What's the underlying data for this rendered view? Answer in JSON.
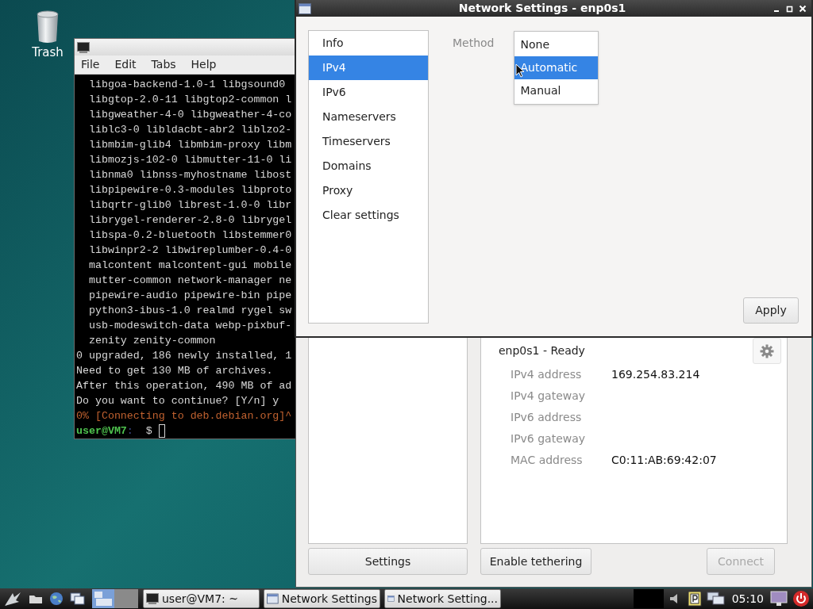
{
  "desktop_icons": [
    {
      "label": "Trash"
    }
  ],
  "terminal": {
    "menu": [
      "File",
      "Edit",
      "Tabs",
      "Help"
    ],
    "lines": [
      {
        "kind": "output",
        "text": "  libgoa-backend-1.0-1 libgsound0"
      },
      {
        "kind": "output",
        "text": "  libgtop-2.0-11 libgtop2-common l"
      },
      {
        "kind": "output",
        "text": "  libgweather-4-0 libgweather-4-co"
      },
      {
        "kind": "output",
        "text": "  liblc3-0 libldacbt-abr2 liblzo2-"
      },
      {
        "kind": "output",
        "text": "  libmbim-glib4 libmbim-proxy libm"
      },
      {
        "kind": "output",
        "text": "  libmozjs-102-0 libmutter-11-0 li"
      },
      {
        "kind": "output",
        "text": "  libnma0 libnss-myhostname libost"
      },
      {
        "kind": "output",
        "text": "  libpipewire-0.3-modules libproto"
      },
      {
        "kind": "output",
        "text": "  libqrtr-glib0 librest-1.0-0 libr"
      },
      {
        "kind": "output",
        "text": "  librygel-renderer-2.8-0 librygel"
      },
      {
        "kind": "output",
        "text": "  libspa-0.2-bluetooth libstemmer0"
      },
      {
        "kind": "output",
        "text": "  libwinpr2-2 libwireplumber-0.4-0"
      },
      {
        "kind": "output",
        "text": "  malcontent malcontent-gui mobile"
      },
      {
        "kind": "output",
        "text": "  mutter-common network-manager ne"
      },
      {
        "kind": "output",
        "text": "  pipewire-audio pipewire-bin pipe"
      },
      {
        "kind": "output",
        "text": "  python3-ibus-1.0 realmd rygel sw"
      },
      {
        "kind": "output",
        "text": "  usb-modeswitch-data webp-pixbuf-"
      },
      {
        "kind": "output",
        "text": "  zenity zenity-common"
      },
      {
        "kind": "output",
        "text": "0 upgraded, 186 newly installed, 1"
      },
      {
        "kind": "output",
        "text": "Need to get 130 MB of archives."
      },
      {
        "kind": "output",
        "text": "After this operation, 490 MB of ad"
      },
      {
        "kind": "output",
        "text": "Do you want to continue? [Y/n] y"
      },
      {
        "kind": "warning",
        "text": "0% [Connecting to deb.debian.org]^"
      }
    ],
    "prompt": {
      "user": "user@VM7",
      "separator": ":",
      "symbol": "$"
    }
  },
  "network_window": {
    "device": {
      "title": "enp0s1 - Ready",
      "details": [
        {
          "label": "IPv4 address",
          "value": "169.254.83.214"
        },
        {
          "label": "IPv4 gateway"
        },
        {
          "label": "IPv6 address"
        },
        {
          "label": "IPv6 gateway"
        },
        {
          "label": "MAC address",
          "value": "C0:11:AB:69:42:07"
        }
      ]
    },
    "buttons": [
      {
        "label": "Settings",
        "disabled": false
      },
      {
        "label": "Enable tethering",
        "disabled": false
      },
      {
        "label": "Connect",
        "disabled": true
      }
    ]
  },
  "dialog": {
    "title": "Network Settings - enp0s1",
    "sections": [
      {
        "label": "Info",
        "selected": false
      },
      {
        "label": "IPv4",
        "selected": true
      },
      {
        "label": "IPv6",
        "selected": false
      },
      {
        "label": "Nameservers",
        "selected": false
      },
      {
        "label": "Timeservers",
        "selected": false
      },
      {
        "label": "Domains",
        "selected": false
      },
      {
        "label": "Proxy",
        "selected": false
      },
      {
        "label": "Clear settings",
        "selected": false
      }
    ],
    "method": {
      "label": "Method",
      "options": [
        {
          "label": "None",
          "selected": false
        },
        {
          "label": "Automatic",
          "selected": true
        },
        {
          "label": "Manual",
          "selected": false
        }
      ]
    },
    "apply": "Apply"
  },
  "taskbar": {
    "tasks": [
      {
        "kind": "terminal",
        "label": "user@VM7: ~"
      },
      {
        "kind": "window",
        "label": "Network Settings"
      },
      {
        "kind": "window",
        "label": "Network Setting..."
      }
    ],
    "clock": "05:10"
  }
}
